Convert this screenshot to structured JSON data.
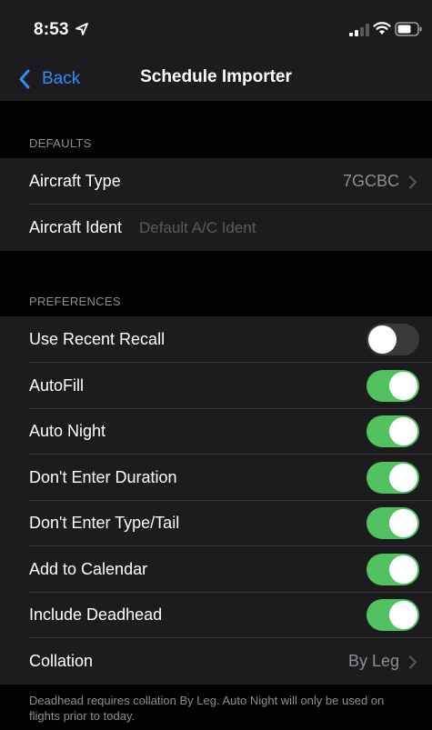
{
  "status": {
    "time": "8:53"
  },
  "nav": {
    "back_label": "Back",
    "title": "Schedule Importer"
  },
  "defaults": {
    "header": "DEFAULTS",
    "aircraft_type_label": "Aircraft Type",
    "aircraft_type_value": "7GCBC",
    "aircraft_ident_label": "Aircraft Ident",
    "aircraft_ident_placeholder": "Default A/C Ident",
    "aircraft_ident_value": ""
  },
  "preferences": {
    "header": "PREFERENCES",
    "toggles": [
      {
        "label": "Use Recent Recall",
        "on": false
      },
      {
        "label": "AutoFill",
        "on": true
      },
      {
        "label": "Auto Night",
        "on": true
      },
      {
        "label": "Don't Enter Duration",
        "on": true
      },
      {
        "label": "Don't Enter Type/Tail",
        "on": true
      },
      {
        "label": "Add to Calendar",
        "on": true
      },
      {
        "label": "Include Deadhead",
        "on": true
      }
    ],
    "collation_label": "Collation",
    "collation_value": "By Leg"
  },
  "footer_note": "Deadhead requires collation By Leg. Auto Night will only be used on flights prior to today.",
  "colors": {
    "accent": "#2f8cff",
    "toggle_on": "#52c15f",
    "toggle_off": "#3a3a3c",
    "background": "#000000",
    "cell": "#1c1c1e",
    "secondary_text": "#8e8e93"
  }
}
